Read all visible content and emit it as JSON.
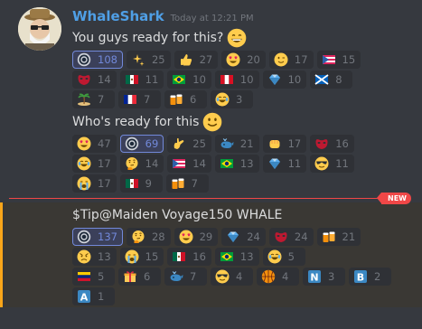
{
  "author": {
    "name": "WhaleShark",
    "timestamp": "Today at 12:21 PM"
  },
  "messages": [
    {
      "text": "You guys ready for this?",
      "emoji": "grin"
    },
    {
      "text": "Who's ready for this",
      "emoji": "slight-smile"
    },
    {
      "text_prefix": "$Tip ",
      "mention": "@Maiden Voyage",
      "text_suffix": " 150 WHALE"
    }
  ],
  "new_badge": "NEW",
  "reaction_rows": [
    [
      {
        "icon": "coin",
        "count": "108",
        "me": true
      },
      {
        "icon": "sparkles",
        "count": "25"
      },
      {
        "icon": "thumbsup",
        "count": "27"
      },
      {
        "icon": "heart-eyes",
        "count": "20"
      },
      {
        "icon": "wink",
        "count": "17"
      },
      {
        "icon": "flag-pr",
        "count": "15"
      }
    ],
    [
      {
        "icon": "mask",
        "count": "14"
      },
      {
        "icon": "flag-mx",
        "count": "11"
      },
      {
        "icon": "flag-br",
        "count": "10"
      },
      {
        "icon": "flag-pe",
        "count": "10"
      },
      {
        "icon": "gem",
        "count": "10"
      },
      {
        "icon": "flag-scotland",
        "count": "8"
      }
    ],
    [
      {
        "icon": "island",
        "count": "7"
      },
      {
        "icon": "flag-fr",
        "count": "7"
      },
      {
        "icon": "beers",
        "count": "6"
      },
      {
        "icon": "joy",
        "count": "3"
      }
    ],
    [
      {
        "icon": "heart-eyes",
        "count": "47"
      },
      {
        "icon": "coin",
        "count": "69",
        "me": true
      },
      {
        "icon": "call-me",
        "count": "25"
      },
      {
        "icon": "whale",
        "count": "21"
      },
      {
        "icon": "fist",
        "count": "17"
      },
      {
        "icon": "mask",
        "count": "16"
      }
    ],
    [
      {
        "icon": "joy",
        "count": "17"
      },
      {
        "icon": "thinking",
        "count": "14"
      },
      {
        "icon": "flag-pr",
        "count": "14"
      },
      {
        "icon": "flag-br",
        "count": "13"
      },
      {
        "icon": "gem",
        "count": "11"
      },
      {
        "icon": "sunglasses",
        "count": "11"
      }
    ],
    [
      {
        "icon": "sob",
        "count": "17"
      },
      {
        "icon": "flag-mx",
        "count": "9"
      },
      {
        "icon": "beers",
        "count": "7"
      }
    ],
    [
      {
        "icon": "coin",
        "count": "137",
        "me": true
      },
      {
        "icon": "thinking",
        "count": "28"
      },
      {
        "icon": "heart-eyes",
        "count": "29"
      },
      {
        "icon": "gem",
        "count": "24"
      },
      {
        "icon": "mask",
        "count": "24"
      },
      {
        "icon": "beers",
        "count": "21"
      }
    ],
    [
      {
        "icon": "angry",
        "count": "13"
      },
      {
        "icon": "sob",
        "count": "15"
      },
      {
        "icon": "flag-mx",
        "count": "16"
      },
      {
        "icon": "flag-br",
        "count": "13"
      },
      {
        "icon": "joy",
        "count": "5"
      }
    ],
    [
      {
        "icon": "flag-ve",
        "count": "5"
      },
      {
        "icon": "gift",
        "count": "6"
      },
      {
        "icon": "whale",
        "count": "7"
      },
      {
        "icon": "sunglasses",
        "count": "4"
      },
      {
        "icon": "basketball",
        "count": "4"
      },
      {
        "icon": "letter-n",
        "count": "3"
      },
      {
        "icon": "letter-b",
        "count": "2"
      }
    ],
    [
      {
        "icon": "letter-a",
        "count": "1"
      }
    ]
  ],
  "colors": {
    "background": "#36393f",
    "username": "#4f9fe6",
    "reaction_bg": "#2f3136",
    "reaction_me_border": "#7289da",
    "new_marker": "#f04747",
    "highlight_bar": "#faa61a"
  }
}
